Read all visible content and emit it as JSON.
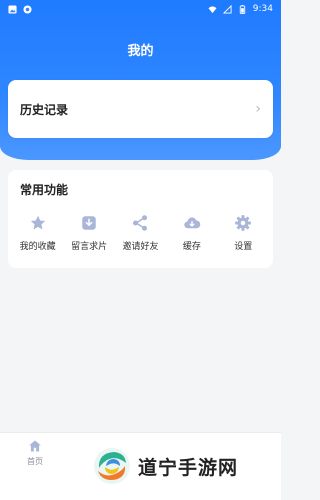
{
  "status_bar": {
    "time": "9:34",
    "left_icons": [
      "image-icon",
      "notification-icon"
    ],
    "right_icons": [
      "wifi-icon",
      "signal-icon",
      "battery-icon"
    ]
  },
  "header": {
    "title": "我的"
  },
  "history": {
    "label": "历史记录"
  },
  "functions": {
    "title": "常用功能",
    "items": [
      {
        "label": "我的收藏",
        "icon": "star-icon"
      },
      {
        "label": "留言求片",
        "icon": "download-box-icon"
      },
      {
        "label": "邀请好友",
        "icon": "share-icon"
      },
      {
        "label": "缓存",
        "icon": "cloud-download-icon"
      },
      {
        "label": "设置",
        "icon": "gear-icon"
      }
    ]
  },
  "bottom_nav": {
    "home_label": "首页"
  },
  "watermark": {
    "text": "道宁手游网"
  },
  "colors": {
    "header": "#2f86ff",
    "icon": "#a9b6d8",
    "background": "#f4f5f7"
  }
}
